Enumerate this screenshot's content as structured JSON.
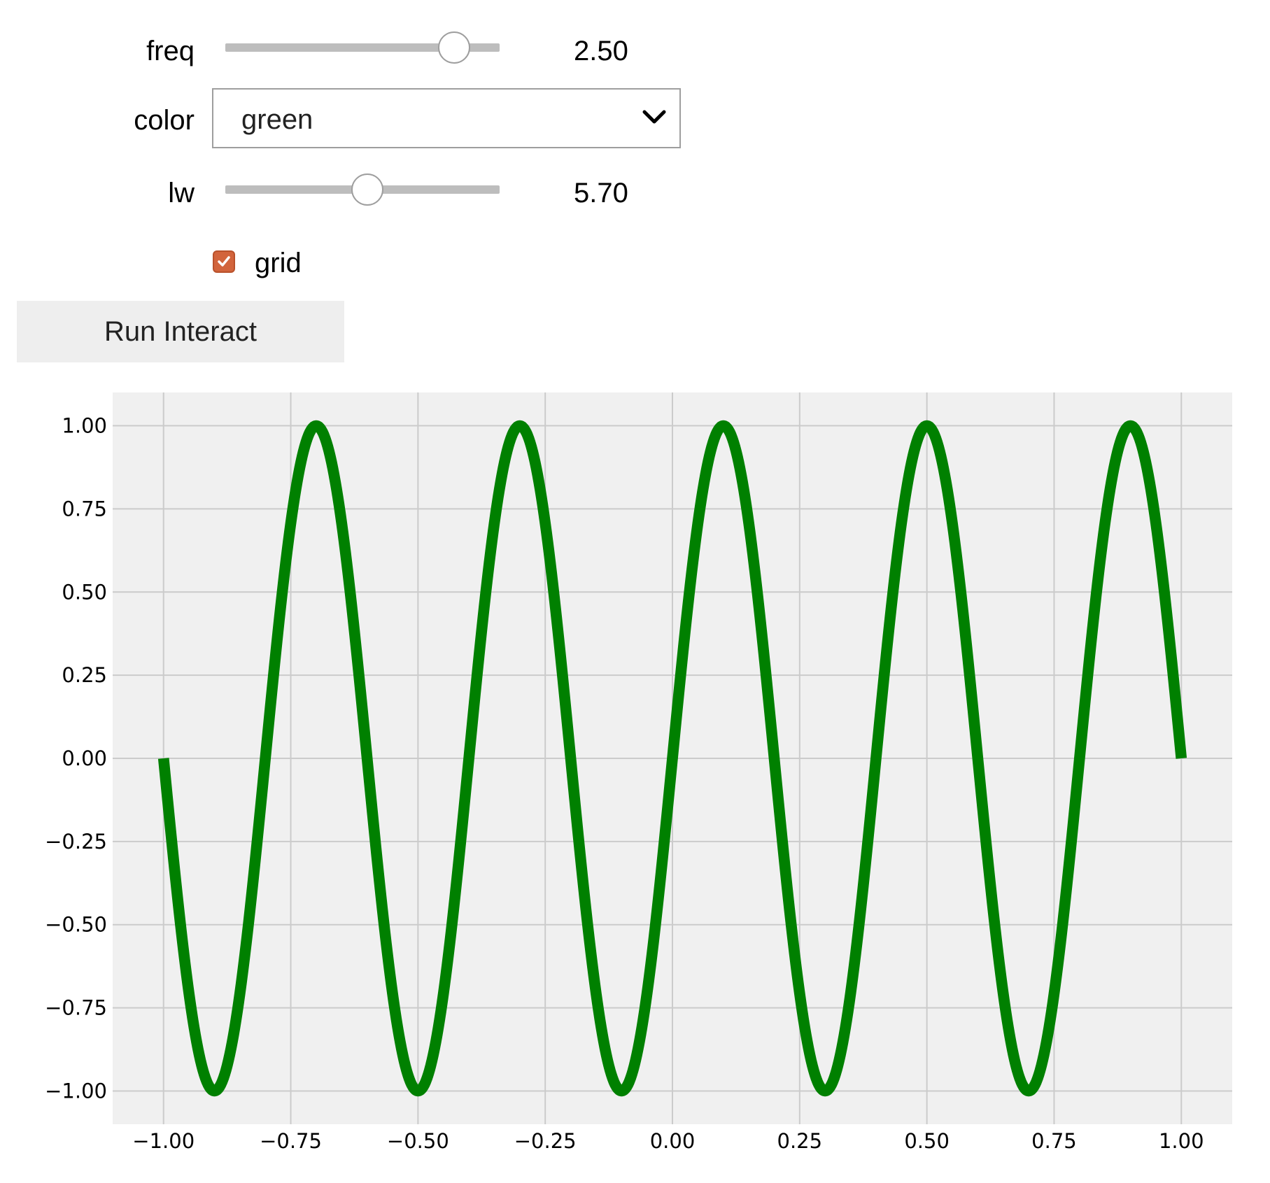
{
  "controls": {
    "freq": {
      "label": "freq",
      "value": 2.5,
      "min": 0,
      "max": 3,
      "display": "2.50"
    },
    "color": {
      "label": "color",
      "selected": "green"
    },
    "lw": {
      "label": "lw",
      "value": 5.7,
      "min": 0,
      "max": 11,
      "display": "5.70"
    },
    "grid": {
      "label": "grid",
      "checked": true
    },
    "run_button_label": "Run Interact"
  },
  "colors": {
    "checkbox": "#d2643c",
    "plot_bg": "#f0f0f0",
    "grid": "#cbcbcb",
    "line": "#008000"
  },
  "chart_data": {
    "type": "line",
    "function": "sin(2*pi*freq*x)",
    "freq": 2.5,
    "x_range": [
      -1,
      1
    ],
    "xlim": [
      -1.1,
      1.1
    ],
    "ylim": [
      -1.1,
      1.1
    ],
    "grid": true,
    "line_color": "green",
    "linewidth": 5.7,
    "xticks": [
      "−1.00",
      "−0.75",
      "−0.50",
      "−0.25",
      "0.00",
      "0.25",
      "0.50",
      "0.75",
      "1.00"
    ],
    "yticks": [
      "1.00",
      "0.75",
      "0.50",
      "0.25",
      "0.00",
      "−0.25",
      "−0.50",
      "−0.75",
      "−1.00"
    ]
  }
}
